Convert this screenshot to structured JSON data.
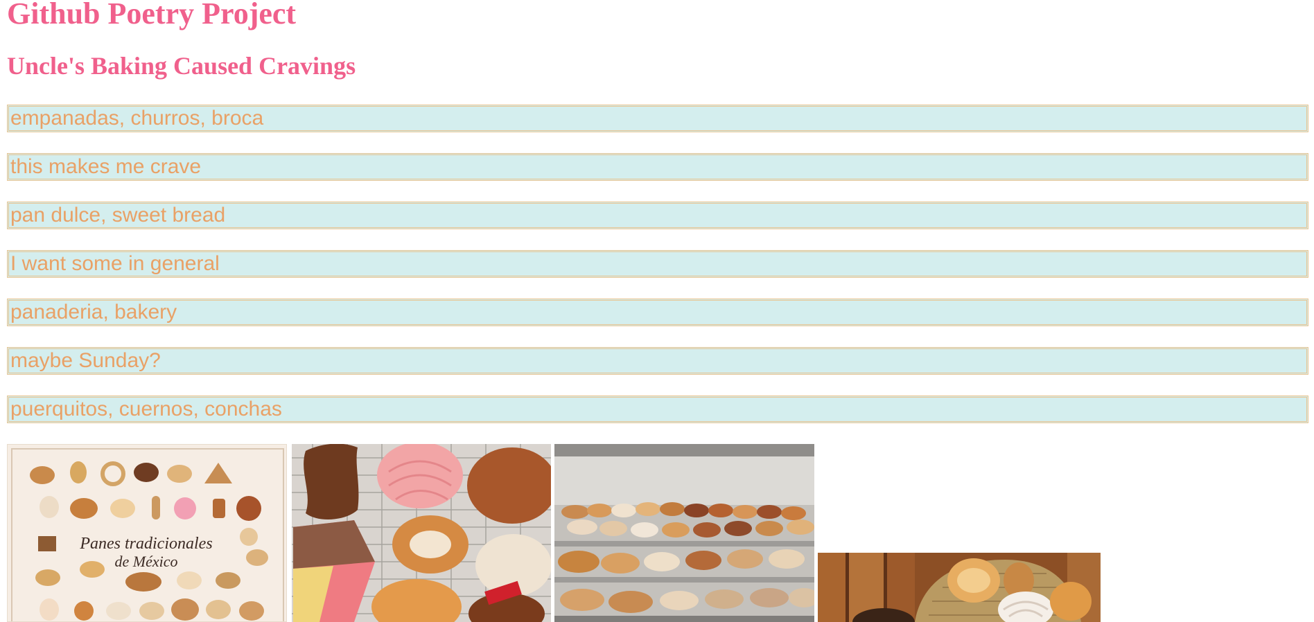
{
  "site": {
    "title": "Github Poetry Project"
  },
  "poem": {
    "title": "Uncle's Baking Caused Cravings",
    "lines": [
      "empanadas, churros, broca",
      "this makes me crave",
      "pan dulce, sweet bread",
      "I want some in general",
      "panaderia, bakery",
      "maybe Sunday?",
      "puerquitos, cuernos, conchas"
    ]
  },
  "gallery": {
    "poster": {
      "caption_line1": "Panes tradicionales",
      "caption_line2": "de México"
    }
  },
  "colors": {
    "heading": "#f0608c",
    "line_text": "#e9a166",
    "line_background": "#d4eeee",
    "line_border": "#e8c491"
  }
}
